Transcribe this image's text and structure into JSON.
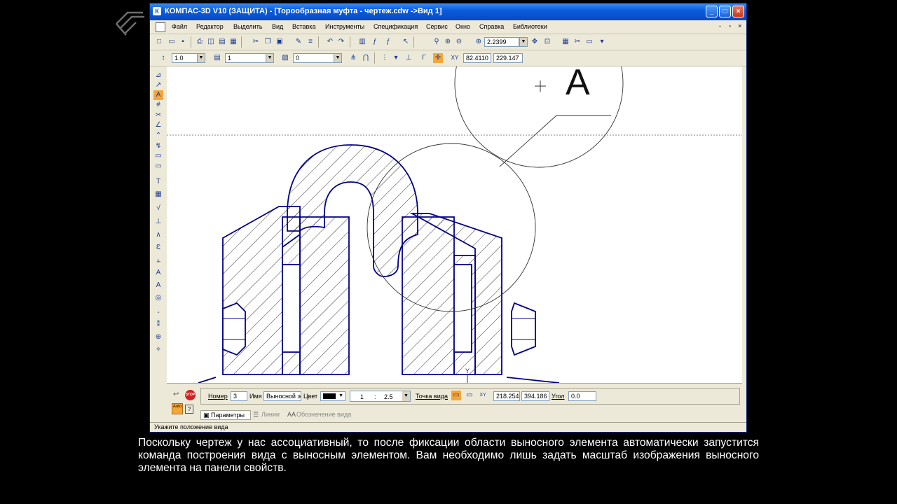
{
  "window": {
    "title": "КОМПАС-3D V10 (ЗАЩИТА) - [Торообразная муфта - чертеж.cdw ->Вид 1]",
    "title_icon": "К",
    "buttons": [
      "_",
      "□",
      "×"
    ]
  },
  "menu": [
    "Файл",
    "Редактор",
    "Выделить",
    "Вид",
    "Вставка",
    "Инструменты",
    "Спецификация",
    "Сервис",
    "Окно",
    "Справка",
    "Библиотеки"
  ],
  "mdi_buttons": [
    "-",
    "▫",
    "×"
  ],
  "toolbar1": {
    "zoom_value": "2.2399"
  },
  "toolbar2": {
    "line_scale": "1.0",
    "layer_value": "1",
    "style_value": "0",
    "x_coord": "82.4110",
    "y_coord": "229.147"
  },
  "drawing": {
    "view_label": "А",
    "line_color": "#00008b",
    "hatch_color": "#000000"
  },
  "properties": {
    "number_label": "Номер",
    "number_value": "3",
    "name_label": "Имя",
    "name_value": "Выносной эл",
    "color_label": "Цвет",
    "scale_left": "1",
    "scale_sep": ":",
    "scale_right": "2.5",
    "view_point_label": "Точка вида",
    "point_x": "218.254",
    "point_y": "394.186",
    "angle_label": "Угол",
    "angle_value": "0.0",
    "stop_label": "STOP",
    "auto_label": "Auto",
    "tabs": [
      "Параметры",
      "Линии",
      "Обозначение вида"
    ]
  },
  "status": {
    "text": "Укажите положение вида"
  },
  "subtitle": "Поскольку чертеж у нас ассоциативный, то после фиксации области выносного элемента автоматически запустится команда построения вида с выносным элементом. Вам необходимо лишь задать масштаб изображения выносного элемента на панели свойств."
}
